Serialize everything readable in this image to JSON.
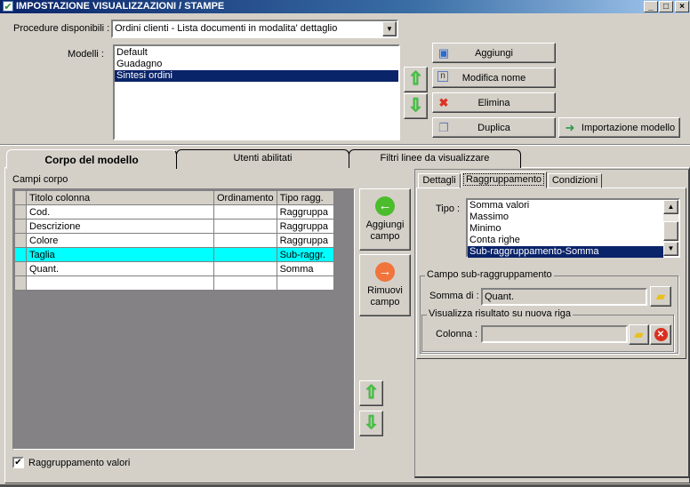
{
  "window": {
    "title": "IMPOSTAZIONE VISUALIZZAZIONI / STAMPE",
    "minimize": "_",
    "maximize": "□",
    "close": "×"
  },
  "procedure": {
    "label": "Procedure disponibili :",
    "value": "Ordini clienti - Lista documenti in modalita' dettaglio"
  },
  "modelli": {
    "label": "Modelli :",
    "items": [
      "Default",
      "Guadagno",
      "Sintesi ordini"
    ],
    "selected": "Sintesi ordini"
  },
  "buttons": {
    "aggiungi": "Aggiungi",
    "modifica": "Modifica nome",
    "elimina": "Elimina",
    "duplica": "Duplica",
    "importazione": "Importazione modello"
  },
  "tabs": [
    {
      "label": "Corpo del modello",
      "active": true
    },
    {
      "label": "Utenti abilitati"
    },
    {
      "label": "Filtri linee da visualizzare"
    }
  ],
  "corpo": {
    "label": "Campi corpo",
    "columns": [
      "Titolo colonna",
      "Ordinamento",
      "Tipo ragg."
    ],
    "rows": [
      [
        "Cod.",
        "",
        "Raggruppa"
      ],
      [
        "Descrizione",
        "",
        "Raggruppa"
      ],
      [
        "Colore",
        "",
        "Raggruppa"
      ],
      [
        "Taglia",
        "",
        "Sub-raggr."
      ],
      [
        "Quant.",
        "",
        "Somma"
      ]
    ],
    "highlighted_row": 3,
    "aggiungi_campo": [
      "Aggiungi",
      "campo"
    ],
    "rimuovi_campo": [
      "Rimuovi",
      "campo"
    ],
    "raggruppamento_valori": {
      "label": "Raggruppamento valori",
      "checked": true
    }
  },
  "subtabs": [
    {
      "label": "Dettagli"
    },
    {
      "label": "Raggruppamento",
      "active": true
    },
    {
      "label": "Condizioni"
    }
  ],
  "raggruppamento": {
    "tipo_label": "Tipo :",
    "tipo_items": [
      "Somma valori",
      "Massimo",
      "Minimo",
      "Conta righe",
      "Sub-raggruppamento-Somma"
    ],
    "tipo_selected": "Sub-raggruppamento-Somma",
    "group_title": "Campo sub-raggruppamento",
    "somma_label": "Somma di :",
    "somma_value": "Quant.",
    "inner_title": "Visualizza risultato su nuova riga",
    "colonna_label": "Colonna :",
    "colonna_value": ""
  },
  "colors": {
    "highlight": "#00ffff",
    "selection": "#0a246a",
    "grid_bg": "#848284"
  }
}
